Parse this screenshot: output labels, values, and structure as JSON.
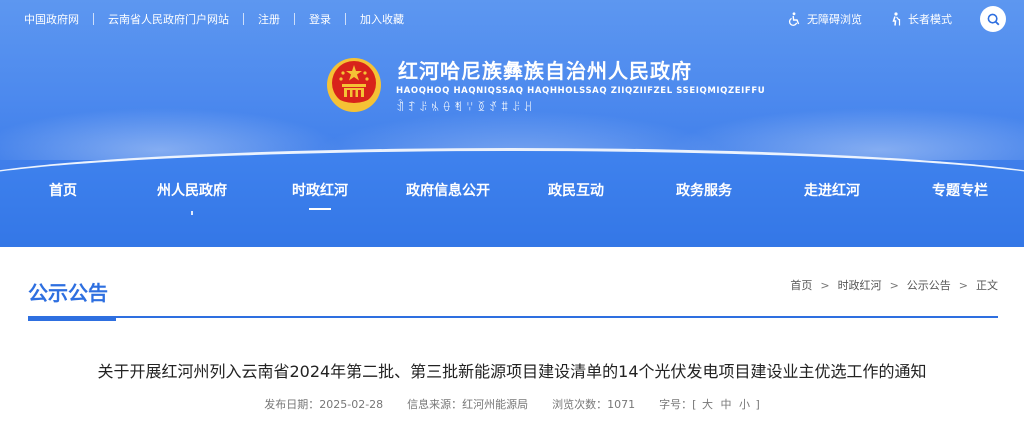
{
  "topbar": {
    "links": [
      "中国政府网",
      "云南省人民政府门户网站",
      "注册",
      "登录",
      "加入收藏"
    ],
    "accessibility_label": "无障碍浏览",
    "elder_label": "长者模式"
  },
  "header": {
    "title": "红河哈尼族彝族自治州人民政府",
    "subtitle": "HAOQHOQ HAQNIQSSAQ HAQHHOLSSAQ ZIIQZIIFZEL SSEIQMIQZEIFFU",
    "yi_text": "ꀉꆈꌠꁱꂷꄮꈌꅉꀋꐚꌠꃅ"
  },
  "nav": {
    "items": [
      "首页",
      "州人民政府",
      "时政红河",
      "政府信息公开",
      "政民互动",
      "政务服务",
      "走进红河",
      "专题专栏"
    ],
    "active": "时政红河"
  },
  "section": {
    "title": "公示公告",
    "breadcrumb": [
      "首页",
      "时政红河",
      "公示公告",
      "正文"
    ],
    "breadcrumb_sep": ">"
  },
  "article": {
    "title": "关于开展红河州列入云南省2024年第二批、第三批新能源项目建设清单的14个光伏发电项目建设业主优选工作的通知",
    "published": "发布日期：2025-02-28",
    "source": "信息来源：红河州能源局",
    "views": "浏览次数：1071",
    "font_size_label": "字号：[",
    "font_sizes": [
      "大",
      "中",
      "小"
    ],
    "font_size_close": "]"
  },
  "colors": {
    "accent": "#2e6fe0",
    "hero": "#3e7de9",
    "emblem_red": "#d8231b",
    "emblem_gold": "#f5c235"
  }
}
